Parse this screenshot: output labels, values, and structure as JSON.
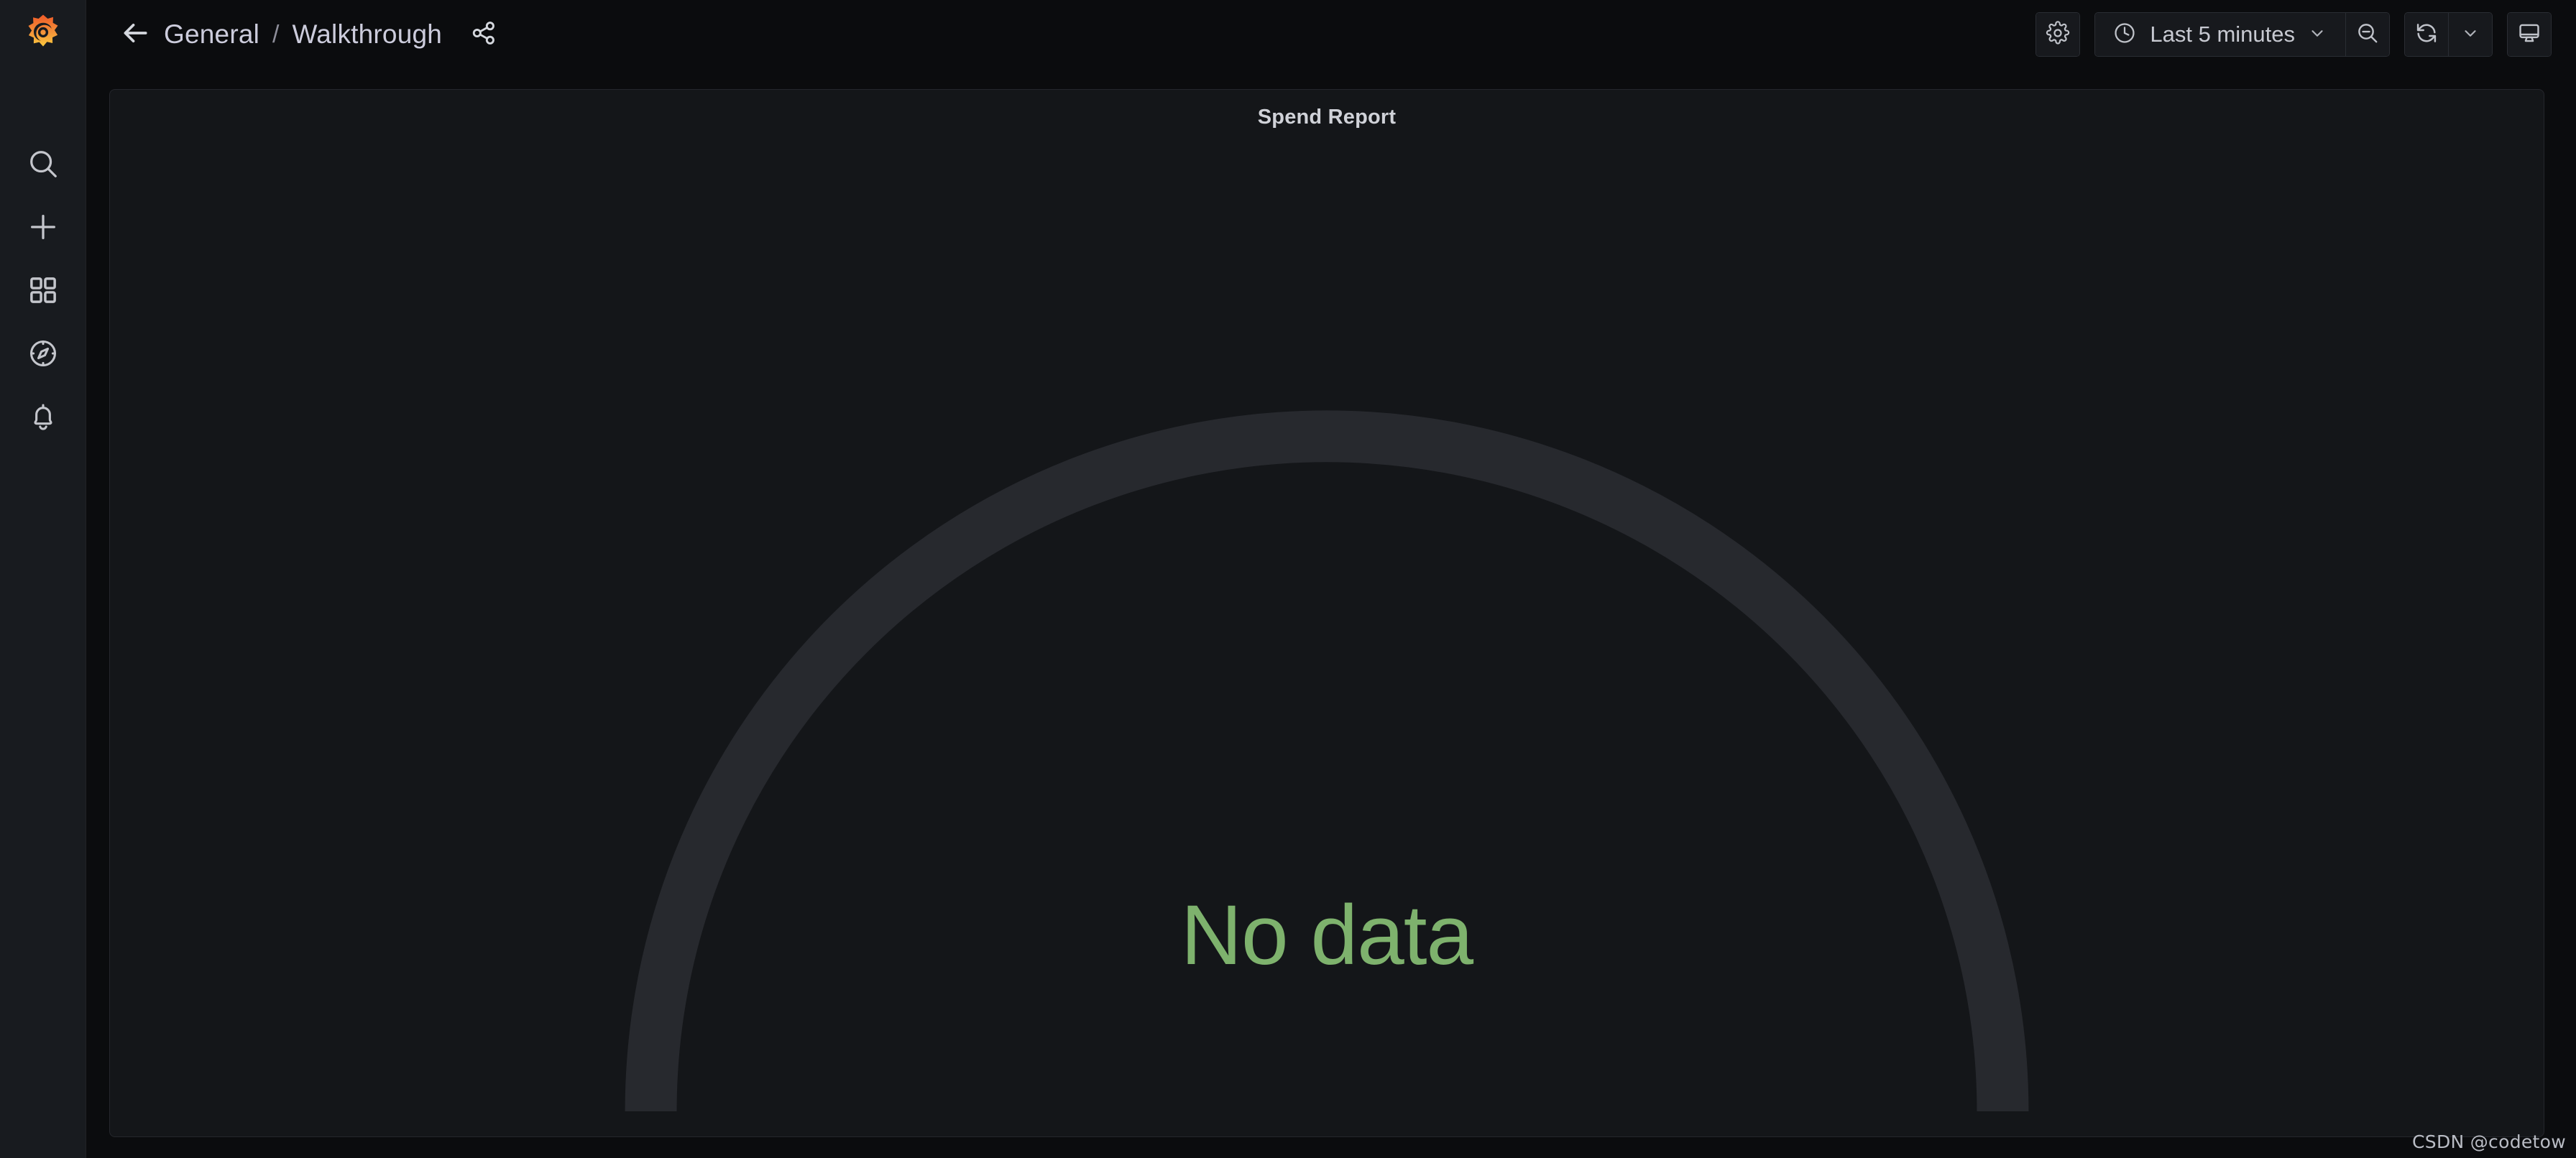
{
  "app": {
    "brand": "grafana-logo",
    "background": "#0b0c0e",
    "panel_background": "#141619",
    "accent_green": "#7eb26d",
    "gauge_track_color": "#27292e"
  },
  "sidebar": {
    "logo_name": "grafana-logo",
    "items": [
      {
        "name": "search",
        "icon": "search-icon",
        "label": "Search"
      },
      {
        "name": "create",
        "icon": "plus-icon",
        "label": "Create"
      },
      {
        "name": "dashboards",
        "icon": "dashboards-icon",
        "label": "Dashboards"
      },
      {
        "name": "explore",
        "icon": "compass-icon",
        "label": "Explore"
      },
      {
        "name": "alerting",
        "icon": "bell-icon",
        "label": "Alerting"
      }
    ]
  },
  "header": {
    "back_icon": "arrow-left-icon",
    "breadcrumb": {
      "folder": "General",
      "separator": "/",
      "dashboard": "Walkthrough"
    },
    "share_icon": "share-icon",
    "toolbar": {
      "settings_icon": "gear-icon",
      "time_picker": {
        "clock_icon": "clock-icon",
        "value": "Last 5 minutes",
        "chevron_icon": "chevron-down-icon"
      },
      "zoom_out_icon": "zoom-out-icon",
      "refresh_icon": "refresh-icon",
      "refresh_chevron_icon": "chevron-down-icon",
      "kiosk_icon": "monitor-icon"
    }
  },
  "panel": {
    "title": "Spend Report",
    "type": "gauge",
    "state": "no-data",
    "no_data_text": "No data"
  },
  "chart_data": {
    "type": "gauge",
    "title": "Spend Report",
    "value": null,
    "display_text": "No data",
    "series": [],
    "track_start_angle": -225,
    "track_end_angle": 45,
    "track_color": "#27292e",
    "value_color": "#7eb26d",
    "grid": false,
    "legend": "none"
  },
  "watermark": {
    "text": "CSDN @codetow"
  }
}
